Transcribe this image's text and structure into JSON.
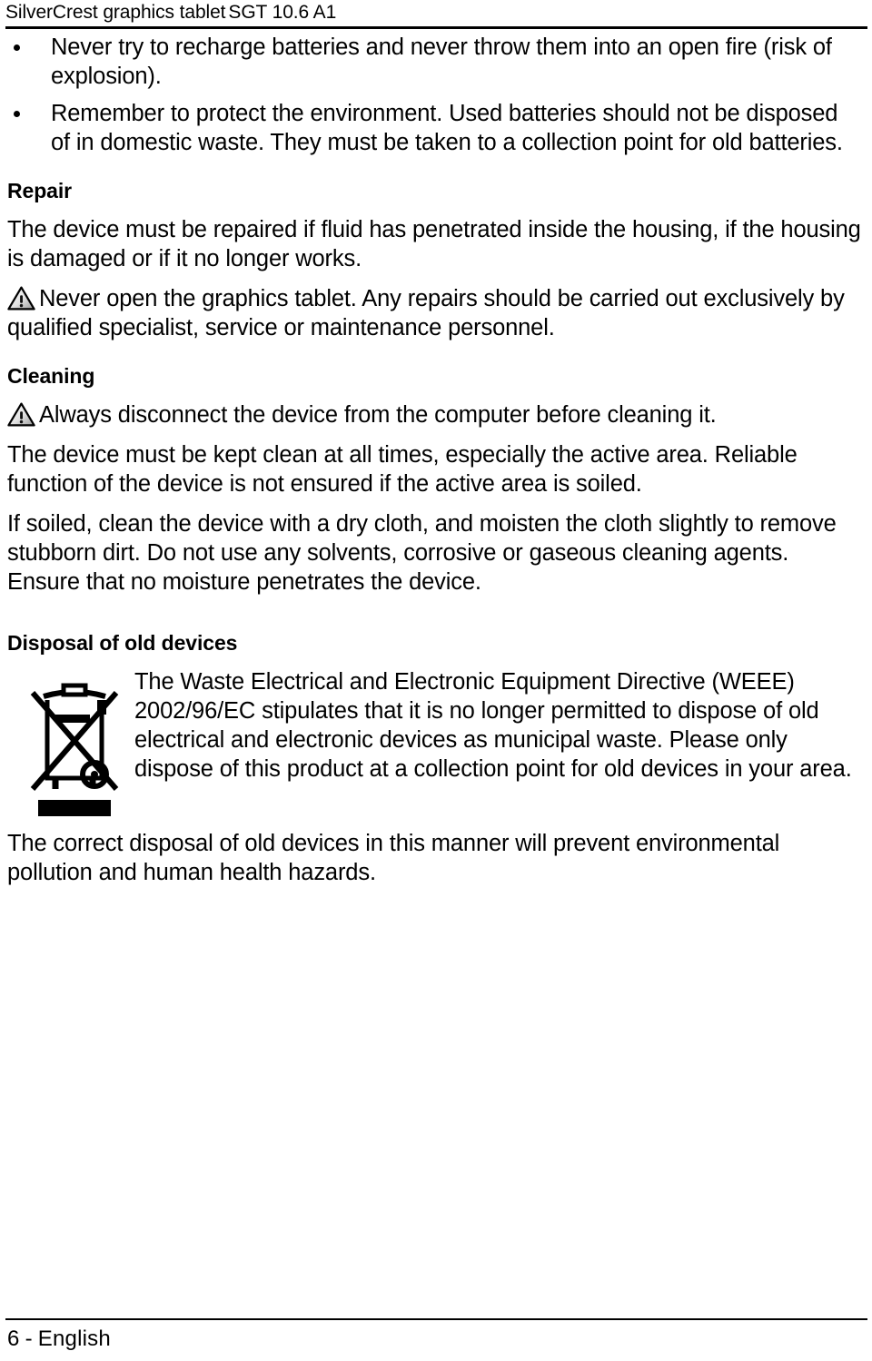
{
  "header": {
    "product": "SilverCrest graphics tablet",
    "model": "SGT 10.6 A1"
  },
  "bullets": [
    "Never try to recharge batteries and never throw them into an open fire (risk of explosion).",
    "Remember to protect the environment. Used batteries should not be disposed of in domestic waste. They must be taken to a collection point for old batteries."
  ],
  "sections": {
    "repair": {
      "heading": "Repair",
      "paragraph_1": "The device must be repaired if fluid has penetrated inside the housing, if the housing is damaged or if it no longer works.",
      "warning_1": "Never open the graphics tablet. Any repairs should be carried out exclusively by qualified specialist, service or maintenance personnel."
    },
    "cleaning": {
      "heading": "Cleaning",
      "warning_1": "Always disconnect the device from the computer before cleaning it.",
      "paragraph_1": "The device must be kept clean at all times, especially the active area. Reliable function of the device is not ensured if the active area is soiled.",
      "paragraph_2": "If soiled, clean the device with a dry cloth, and moisten the cloth slightly to remove stubborn dirt. Do not use any solvents, corrosive or gaseous cleaning agents. Ensure that no moisture penetrates the device."
    },
    "disposal": {
      "heading": "Disposal of old devices",
      "paragraph_1": "The Waste Electrical and Electronic Equipment Directive (WEEE) 2002/96/EC stipulates that it is no longer permitted to dispose of old electrical and electronic devices as municipal waste. Please only dispose of this product at a collection point for old devices in your area.",
      "paragraph_2": "The correct disposal of old devices in this manner will prevent environmental pollution and human health hazards."
    }
  },
  "icons": {
    "warning_triangle": "warning-triangle-icon",
    "weee_bin": "crossed-out-wheelie-bin-icon"
  },
  "footer": {
    "page_number": "6",
    "separator": "-",
    "language": "English"
  },
  "colors": {
    "text": "#000000",
    "background": "#ffffff",
    "rule": "#000000"
  }
}
